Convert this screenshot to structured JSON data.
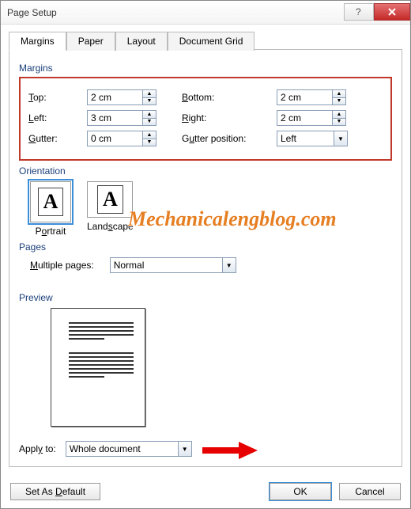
{
  "window": {
    "title": "Page Setup"
  },
  "tabs": [
    "Margins",
    "Paper",
    "Layout",
    "Document Grid"
  ],
  "groups": {
    "margins": "Margins",
    "orientation": "Orientation",
    "pages": "Pages",
    "preview": "Preview"
  },
  "margins": {
    "top": {
      "accel": "T",
      "rest": "op:",
      "value": "2 cm"
    },
    "bottom": {
      "accel": "B",
      "rest": "ottom:",
      "value": "2 cm"
    },
    "left": {
      "accel": "L",
      "rest": "eft:",
      "value": "3 cm"
    },
    "right": {
      "accel": "R",
      "rest": "ight:",
      "value": "2 cm"
    },
    "gutter": {
      "accel": "G",
      "rest": "utter:",
      "value": "0 cm"
    },
    "gutter_position": {
      "accel": "u",
      "rest": "tter position:",
      "value": "Left"
    }
  },
  "orientation": {
    "portrait": {
      "pre": "P",
      "accel": "o",
      "post": "rtrait"
    },
    "landscape": {
      "pre": "Land",
      "accel": "s",
      "post": "cape"
    },
    "selected": "portrait"
  },
  "pages": {
    "multiple": {
      "accel": "M",
      "rest": "ultiple pages:",
      "value": "Normal"
    }
  },
  "apply": {
    "pre": "Appl",
    "accel": "y",
    "post": " to:",
    "value": "Whole document"
  },
  "buttons": {
    "set_default": {
      "pre": "Set As ",
      "accel": "D",
      "post": "efault"
    },
    "ok": "OK",
    "cancel": "Cancel"
  },
  "overlay": {
    "watermark": "Mechanicalengblog.com"
  },
  "colors": {
    "highlight_border": "#c0392b",
    "arrow": "#e60000",
    "watermark": "#e67e22",
    "focus": "#3b8ed8"
  }
}
